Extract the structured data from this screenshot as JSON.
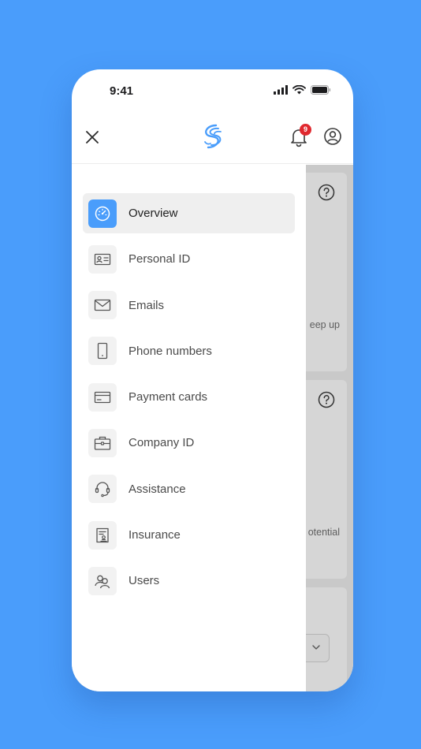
{
  "status_bar": {
    "time": "9:41"
  },
  "header": {
    "notification_count": "9"
  },
  "menu": {
    "items": [
      {
        "label": "Overview",
        "icon": "dashboard-icon",
        "active": true
      },
      {
        "label": "Personal ID",
        "icon": "id-card-icon"
      },
      {
        "label": "Emails",
        "icon": "envelope-icon"
      },
      {
        "label": "Phone numbers",
        "icon": "phone-icon"
      },
      {
        "label": "Payment cards",
        "icon": "credit-card-icon"
      },
      {
        "label": "Company ID",
        "icon": "briefcase-icon"
      },
      {
        "label": "Assistance",
        "icon": "headset-icon"
      },
      {
        "label": "Insurance",
        "icon": "insurance-document-icon"
      },
      {
        "label": "Users",
        "icon": "users-icon"
      }
    ]
  },
  "background_content": {
    "card1_text": "eep up",
    "card2_text": "otential"
  },
  "colors": {
    "accent": "#4a9dfb",
    "badge": "#e0282e",
    "dim_overlay": "#c9c9c9"
  }
}
